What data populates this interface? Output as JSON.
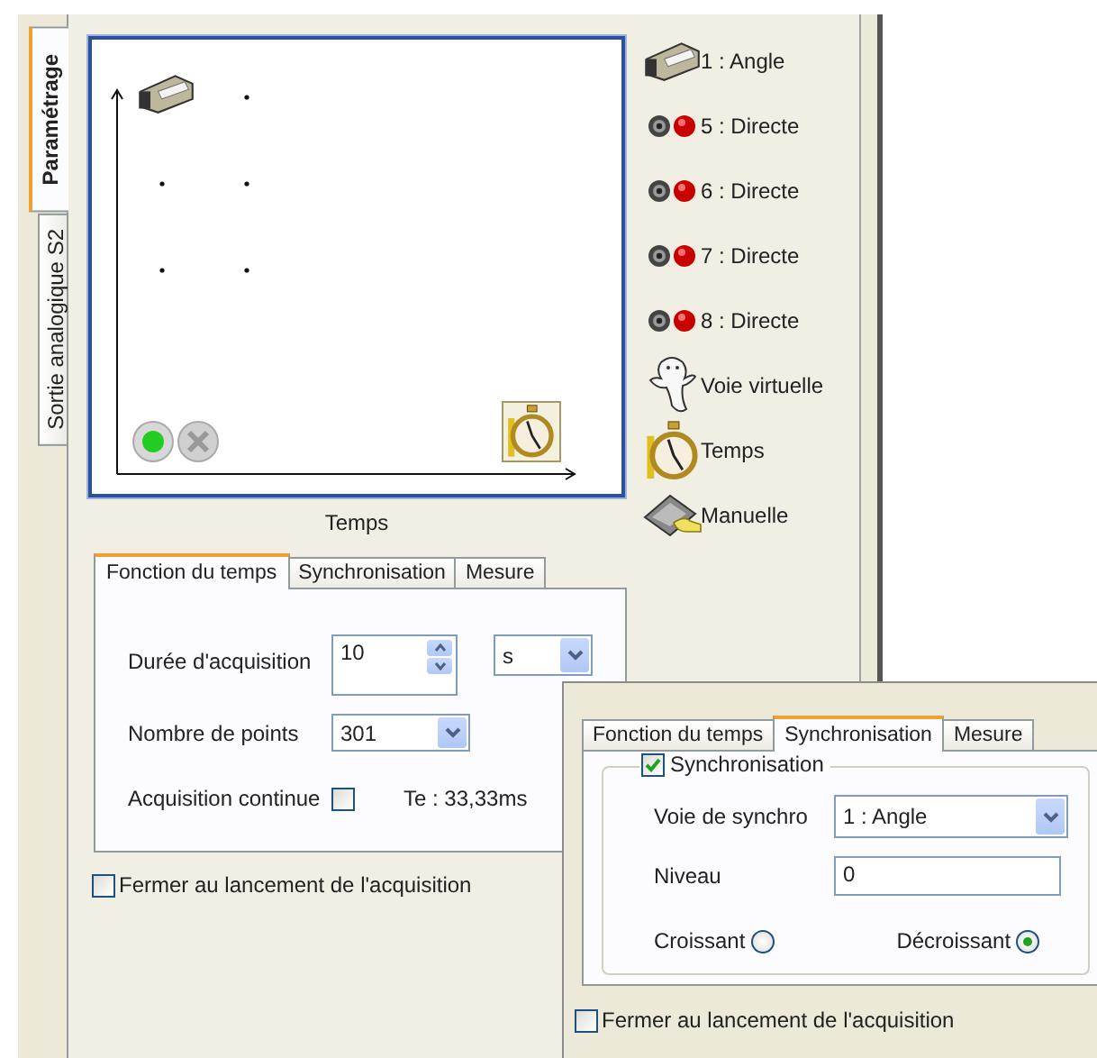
{
  "side_tabs": [
    {
      "label": "Paramétrage",
      "selected": true
    },
    {
      "label": "Sortie analogique S2",
      "selected": false
    }
  ],
  "graph": {
    "x_axis_label": "Temps"
  },
  "channels": [
    {
      "kind": "sensor",
      "label": "1 : Angle"
    },
    {
      "kind": "direct",
      "label": "5 : Directe"
    },
    {
      "kind": "direct",
      "label": "6 : Directe"
    },
    {
      "kind": "direct",
      "label": "7 : Directe"
    },
    {
      "kind": "direct",
      "label": "8 : Directe"
    },
    {
      "kind": "virtual",
      "label": "Voie virtuelle"
    },
    {
      "kind": "time",
      "label": "Temps"
    },
    {
      "kind": "manual",
      "label": "Manuelle"
    }
  ],
  "panel": {
    "tabs": [
      {
        "label": "Fonction du temps",
        "selected": true
      },
      {
        "label": "Synchronisation",
        "selected": false
      },
      {
        "label": "Mesure",
        "selected": false
      }
    ],
    "duration": {
      "label": "Durée d'acquisition",
      "value": "10",
      "unit": "s"
    },
    "points": {
      "label": "Nombre de points",
      "value": "301"
    },
    "continuous": {
      "label": "Acquisition continue",
      "checked": false
    },
    "period": "Te : 33,33ms"
  },
  "close_on_start": {
    "label": "Fermer au lancement de l'acquisition",
    "checked": false
  },
  "overlay": {
    "tabs": [
      {
        "label": "Fonction du temps",
        "selected": false
      },
      {
        "label": "Synchronisation",
        "selected": true
      },
      {
        "label": "Mesure",
        "selected": false
      }
    ],
    "sync": {
      "label": "Synchronisation",
      "checked": true
    },
    "channel": {
      "label": "Voie de synchro",
      "value": "1 : Angle"
    },
    "level": {
      "label": "Niveau",
      "value": "0"
    },
    "edges": [
      {
        "label": "Croissant",
        "selected": false
      },
      {
        "label": "Décroissant",
        "selected": true
      }
    ],
    "close_on_start": {
      "label": "Fermer au lancement de l'acquisition",
      "checked": false
    }
  }
}
